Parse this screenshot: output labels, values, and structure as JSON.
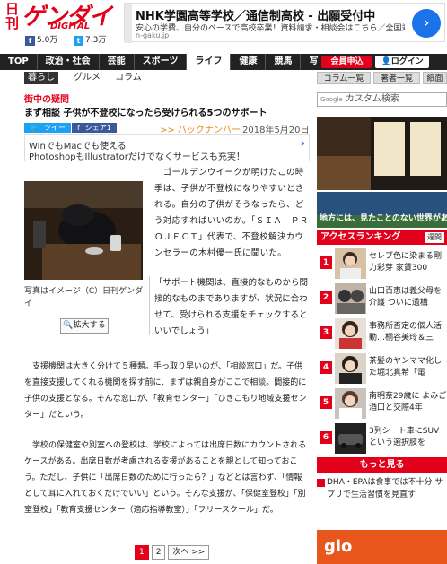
{
  "header": {
    "logo_top": "日刊",
    "logo_main": "ゲンダイ",
    "logo_sub": "DIGITAL",
    "fb_count": "5.0万",
    "tw_count": "7.3万",
    "fb_icon": "facebook-icon",
    "tw_icon": "twitter-icon"
  },
  "top_ad": {
    "title": "NHK学園高等学校／通信制高校 - 出願受付中",
    "desc": "安心の学費、自分のペースで高校卒業！資料請求・相談会はこちら／全国対応",
    "url": "n-gaku.jp"
  },
  "nav": {
    "items": [
      "TOP",
      "政治・社会",
      "芸能",
      "スポーツ",
      "ライフ",
      "健康",
      "競馬",
      "写"
    ],
    "active": "ライフ",
    "signup": "会員申込",
    "login": "ログイン"
  },
  "subnav": {
    "items": [
      "暮らし",
      "グルメ",
      "コラム"
    ],
    "active": "暮らし",
    "buttons": [
      "コラム一覧",
      "著者一覧",
      "紙面"
    ]
  },
  "article": {
    "category": "街中の疑問",
    "headline": "まず相談 子供が不登校になったら受けられる5つのサポート",
    "share": [
      "ツイー",
      "シェア1"
    ],
    "backnumber": ">> バックナンバー",
    "date": "2018年5月20日",
    "ad_line1": "WinでもMacでも使える",
    "ad_line2": "PhotoshopもIllustratorだけでなくサービスも充実！",
    "caption": "写真はイメージ（C）日刊ゲンダイ",
    "zoom": "拡大する",
    "p1": "　ゴールデンウイークが明けたこの時季は、子供が不登校になりやすいとされる。自分の子供がそうなったら、どう対応すればいいのか。「ＳＩＡ　ＰＲＯＪＥＣＴ」代表で、不登校解決カウンセラーの木村優一氏に聞いた。",
    "quote": "「サポート機関は、直接的なものから間接的なものまでありますが、状況に合わせて、受けられる支援をチェックするといいでしょう」",
    "p2": "　支援機関は大きく分けて５種類。手っ取り早いのが、「相談窓口」だ。子供を直接支援してくれる機関を探す前に、まずは親自身がここで相談。間接的に子供の支援となる。そんな窓口が、「教育センター」「ひきこもり地域支援センター」だという。",
    "p3": "　学校の保健室や別室への登校は、学校によっては出席日数にカウントされるケースがある。出席日数が考慮される支援があることを親として知っておこう。ただし、子供に「出席日数のために行ったら？」などとは言わず、「情報として耳に入れておくだけでいい」という。そんな支援が、「保健室登校」「別室登校」「教育支援センター（適応指導教室）」「フリースクール」だ。",
    "pages": [
      "1",
      "2",
      "次へ >>"
    ]
  },
  "sidebar": {
    "search_placeholder": "カスタム検索",
    "search_brand": "Google",
    "promo_text": "地方には、見たことのない世界がある。",
    "ranking_title": "アクセスランキング",
    "ranking_tab": "週間",
    "ranking": [
      {
        "rank": "1",
        "text": "セレブ色に染まる剛力彩芽 家賃300"
      },
      {
        "rank": "2",
        "text": "山口百恵は義父母を介護 ついに遺構"
      },
      {
        "rank": "3",
        "text": "事務所否定の個人活動…桐谷美玲＆三"
      },
      {
        "rank": "4",
        "text": "茶髪のヤンママ化した堀北真希「電"
      },
      {
        "rank": "5",
        "text": "南明奈29歳に よみご酒口と交際4年"
      },
      {
        "rank": "6",
        "text": "3列シート車にSUVという選択肢を"
      }
    ],
    "more_title": "もっと見る",
    "more_items": [
      "DHA・EPAは食事では不十分 サプリで生活習慣を見直す"
    ],
    "glo": "glo"
  }
}
